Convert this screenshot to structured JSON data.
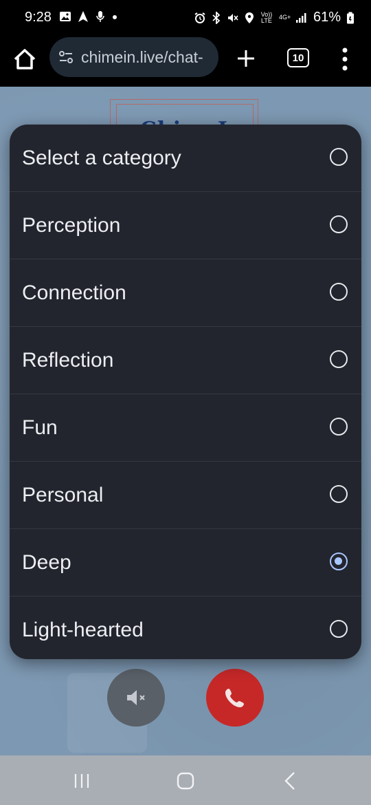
{
  "status_bar": {
    "time": "9:28",
    "battery": "61%",
    "volte": "Vo)) LTE",
    "network": "4G+",
    "icons": [
      "gallery-icon",
      "navigation-icon",
      "mic-icon",
      "dot-icon",
      "alarm-icon",
      "bluetooth-icon",
      "mute-icon",
      "location-icon",
      "signal-icon",
      "battery-icon"
    ]
  },
  "browser": {
    "url": "chimein.live/chat-",
    "tab_count": "10"
  },
  "page": {
    "logo_text": "ChimeIn"
  },
  "dialog": {
    "options": [
      {
        "label": "Select a category",
        "selected": false
      },
      {
        "label": "Perception",
        "selected": false
      },
      {
        "label": "Connection",
        "selected": false
      },
      {
        "label": "Reflection",
        "selected": false
      },
      {
        "label": "Fun",
        "selected": false
      },
      {
        "label": "Personal",
        "selected": false
      },
      {
        "label": "Deep",
        "selected": true
      },
      {
        "label": "Light-hearted",
        "selected": false
      }
    ]
  },
  "colors": {
    "dialog_bg": "#23252e",
    "radio_selected": "#a9c7ff",
    "end_call": "#c62828",
    "page_bg": "#7d98b2"
  }
}
